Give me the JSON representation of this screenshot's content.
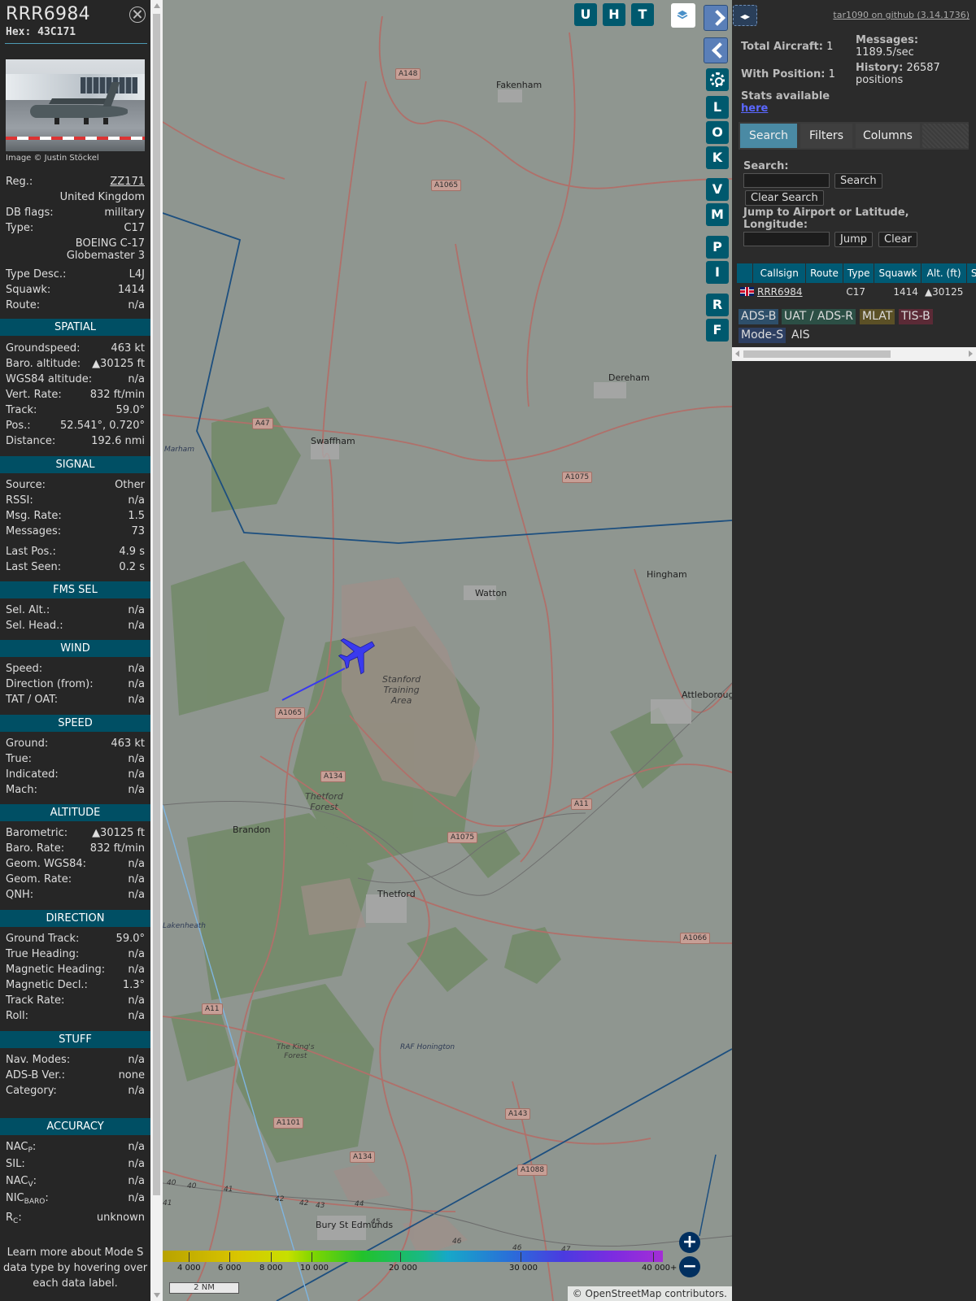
{
  "aircraft": {
    "callsign": "RRR6984",
    "hex": "Hex: 43C171",
    "image_credit": "Image © Justin Stöckel"
  },
  "details": [
    {
      "k": "Reg.:",
      "v": "ZZ171",
      "link": true
    },
    {
      "k": "",
      "v": "United Kingdom"
    },
    {
      "k": "DB flags:",
      "v": "military"
    },
    {
      "k": "Type:",
      "v": "C17"
    },
    {
      "k": "",
      "v": "BOEING C-17"
    },
    {
      "k": "",
      "v": "Globemaster 3"
    },
    {
      "k": "Type Desc.:",
      "v": "L4J"
    },
    {
      "k": "Squawk:",
      "v": "1414"
    },
    {
      "k": "Route:",
      "v": "n/a"
    }
  ],
  "sections": {
    "spatial": "SPATIAL",
    "signal": "SIGNAL",
    "fms": "FMS SEL",
    "wind": "WIND",
    "speed": "SPEED",
    "altitude": "ALTITUDE",
    "direction": "DIRECTION",
    "stuff": "STUFF",
    "accuracy": "ACCURACY"
  },
  "spatial": [
    {
      "k": "Groundspeed:",
      "v": "463 kt"
    },
    {
      "k": "Baro. altitude:",
      "v": "▲30125 ft"
    },
    {
      "k": "WGS84 altitude:",
      "v": "n/a"
    },
    {
      "k": "Vert. Rate:",
      "v": "832 ft/min"
    },
    {
      "k": "Track:",
      "v": "59.0°"
    },
    {
      "k": "Pos.:",
      "v": "52.541°, 0.720°"
    },
    {
      "k": "Distance:",
      "v": "192.6 nmi"
    }
  ],
  "signal": [
    {
      "k": "Source:",
      "v": "Other"
    },
    {
      "k": "RSSI:",
      "v": "n/a"
    },
    {
      "k": "Msg. Rate:",
      "v": "1.5"
    },
    {
      "k": "Messages:",
      "v": "73"
    },
    {
      "k": "Last Pos.:",
      "v": "4.9 s"
    },
    {
      "k": "Last Seen:",
      "v": "0.2 s"
    }
  ],
  "fms": [
    {
      "k": "Sel. Alt.:",
      "v": "n/a"
    },
    {
      "k": "Sel. Head.:",
      "v": "n/a"
    }
  ],
  "wind": [
    {
      "k": "Speed:",
      "v": "n/a"
    },
    {
      "k": "Direction (from):",
      "v": "n/a"
    },
    {
      "k": "TAT / OAT:",
      "v": "n/a"
    }
  ],
  "speed": [
    {
      "k": "Ground:",
      "v": "463 kt"
    },
    {
      "k": "True:",
      "v": "n/a"
    },
    {
      "k": "Indicated:",
      "v": "n/a"
    },
    {
      "k": "Mach:",
      "v": "n/a"
    }
  ],
  "altitude": [
    {
      "k": "Barometric:",
      "v": "▲30125 ft"
    },
    {
      "k": "Baro. Rate:",
      "v": "832 ft/min"
    },
    {
      "k": "Geom. WGS84:",
      "v": "n/a"
    },
    {
      "k": "Geom. Rate:",
      "v": "n/a"
    },
    {
      "k": "QNH:",
      "v": "n/a"
    }
  ],
  "direction": [
    {
      "k": "Ground Track:",
      "v": "59.0°"
    },
    {
      "k": "True Heading:",
      "v": "n/a"
    },
    {
      "k": "Magnetic Heading:",
      "v": "n/a"
    },
    {
      "k": "Magnetic Decl.:",
      "v": "1.3°"
    },
    {
      "k": "Track Rate:",
      "v": "n/a"
    },
    {
      "k": "Roll:",
      "v": "n/a"
    }
  ],
  "stuff": [
    {
      "k": "Nav. Modes:",
      "v": "n/a"
    },
    {
      "k": "ADS-B Ver.:",
      "v": "none"
    },
    {
      "k": "Category:",
      "v": "n/a"
    }
  ],
  "accuracy": [
    {
      "k": "NAC",
      "sub": "P",
      "v": "n/a"
    },
    {
      "k": "SIL:",
      "sub": "",
      "v": "n/a"
    },
    {
      "k": "NAC",
      "sub": "V",
      "v": "n/a"
    },
    {
      "k": "NIC",
      "sub": "BARO",
      "v": "n/a"
    },
    {
      "k": "R",
      "sub": "C",
      "v": "unknown"
    }
  ],
  "note": "Learn more about Mode S data type by hovering over each data label.",
  "map": {
    "buttons_top": [
      "U",
      "H",
      "T"
    ],
    "buttons_side": [
      "L",
      "O",
      "K",
      "V",
      "M",
      "P",
      "I",
      "R",
      "F"
    ],
    "places": [
      "Fakenham",
      "Dereham",
      "Swaffham",
      "Marham",
      "Watton",
      "Hingham",
      "Attleborough",
      "Brandon",
      "Thetford",
      "Lakenheath",
      "RAF Honington",
      "Bury St Edmunds"
    ],
    "areas": [
      "Stanford\nTraining\nArea",
      "Thetford\nForest",
      "The King's\nForest"
    ],
    "roads": [
      "A148",
      "A1065",
      "A47",
      "A1075",
      "A1065",
      "A134",
      "A11",
      "A1075",
      "A1066",
      "A11",
      "A143",
      "A1101",
      "A134",
      "A1088"
    ],
    "contours": [
      "40",
      "40",
      "41",
      "41",
      "42",
      "42",
      "43",
      "44",
      "45",
      "46",
      "46",
      "47"
    ],
    "altitude_scale": [
      "4 000",
      "6 000",
      "8 000",
      "10 000",
      "20 000",
      "30 000",
      "40 000+"
    ],
    "scale": "2 NM",
    "attribution_pre": "© ",
    "attribution_link": "OpenStreetMap",
    "attribution_post": " contributors.",
    "zoom_in": "+",
    "zoom_out": "−"
  },
  "stats": {
    "github": "tar1090 on github (3.14.1736)",
    "total_label": "Total Aircraft:",
    "total_value": "1",
    "pos_label": "With Position:",
    "pos_value": "1",
    "msg_label": "Messages:",
    "msg_value": "1189.5/sec",
    "hist_label": "History:",
    "hist_value": "26587",
    "hist_unit": "positions",
    "stats_label": "Stats available",
    "stats_link": "here"
  },
  "search": {
    "tabs": [
      "Search",
      "Filters",
      "Columns"
    ],
    "search_label": "Search:",
    "search_btn": "Search",
    "clear_btn": "Clear Search",
    "jump_label": "Jump to Airport or Latitude, Longitude:",
    "jump_btn": "Jump",
    "clear2_btn": "Clear"
  },
  "table": {
    "columns": [
      "",
      "Callsign",
      "Route",
      "Type",
      "Squawk",
      "Alt. (ft)",
      "Sp"
    ],
    "rows": [
      {
        "callsign": "RRR6984",
        "route": "",
        "type": "C17",
        "squawk": "1414",
        "alt": "▲30125",
        "sp": ""
      }
    ]
  },
  "sources": [
    {
      "label": "ADS-B",
      "color": "#2e4f6a"
    },
    {
      "label": "UAT / ADS-R",
      "color": "#2c4f45"
    },
    {
      "label": "MLAT",
      "color": "#5b5026"
    },
    {
      "label": "TIS-B",
      "color": "#5b2a36"
    },
    {
      "label": "Mode-S",
      "color": "#2d3f62"
    },
    {
      "label": "AIS",
      "color": "#2b2b2b"
    }
  ]
}
